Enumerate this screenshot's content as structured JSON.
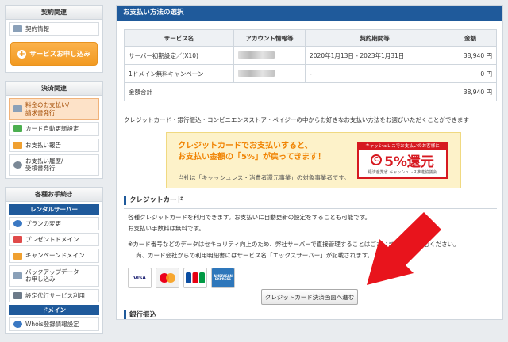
{
  "sidebar": {
    "contract": {
      "title": "契約関連",
      "items": [
        {
          "label": "契約情報",
          "icon": "document-icon"
        }
      ],
      "order_button": "サービスお申し込み"
    },
    "payment": {
      "title": "決済関連",
      "items": [
        {
          "label1": "料金のお支払い/",
          "label2": "請求書発行",
          "icon": "document-icon",
          "active": true
        },
        {
          "label1": "カード自動更新設定",
          "label2": "",
          "icon": "credit-card-icon"
        },
        {
          "label1": "お支払い報告",
          "label2": "",
          "icon": "pencil-icon"
        },
        {
          "label1": "お支払い履歴/",
          "label2": "受領書発行",
          "icon": "clock-icon"
        }
      ]
    },
    "procedures": {
      "title": "各種お手続き",
      "rental_header": "レンタルサーバー",
      "items": [
        {
          "label1": "プランの変更",
          "label2": ""
        },
        {
          "label1": "プレゼントドメイン",
          "label2": ""
        },
        {
          "label1": "キャンペーンドメイン",
          "label2": ""
        },
        {
          "label1": "バックアップデータ",
          "label2": "お申し込み"
        },
        {
          "label1": "設定代行サービス利用",
          "label2": ""
        }
      ],
      "domain_header": "ドメイン",
      "domain_item": "Whois登録情報設定"
    }
  },
  "main": {
    "title": "お支払い方法の選択",
    "table": {
      "headers": [
        "サービス名",
        "アカウント情報等",
        "契約期間等",
        "金額"
      ],
      "rows": [
        {
          "service": "サーバー初期設定／(X10)",
          "period": "2020年1月13日 - 2023年1月31日",
          "amount": "38,940 円"
        },
        {
          "service": "1ドメイン無料キャンペーン",
          "period": "-",
          "amount": "0 円"
        }
      ],
      "total_label": "金額合計",
      "total_amount": "38,940 円"
    },
    "intro": "クレジットカード・銀行振込・コンビニエンスストア・ペイジーの中からお好きなお支払い方法をお選びいただくことができます",
    "banner": {
      "line1": "クレジットカードでお支払いすると、",
      "line2": "お支払い金額の「5%」が戻ってきます！",
      "sub": "当社は「キャッシュレス・消費者還元事業」の対象事業者です。",
      "logo_top": "キャッシュレスでお支払いのお客様に",
      "logo_main": "5%還元",
      "logo_bottom": "経済産業省 キャッシュレス推進協議会"
    },
    "credit": {
      "title": "クレジットカード",
      "desc1": "各種クレジットカードを利用できます。お支払いに自動更新の設定をすることも可能です。",
      "desc2": "お支払い手数料は無料です。",
      "note1": "※カード番号などのデータはセキュリティ向上のため、弊社サーバーで直接管理することはございません。ご安心ください。",
      "note2": "尚、カード会社からの利用明細書にはサービス名「エックスサーバー」が記載されます。",
      "cards": [
        "VISA",
        "MasterCard",
        "JCB",
        "AMERICAN EXPRESS"
      ],
      "button": "クレジットカード決済画面へ進む"
    },
    "bank": {
      "title": "銀行振込"
    }
  },
  "colors": {
    "header_blue": "#1f5a9b",
    "accent_orange": "#f29a21",
    "arrow_red": "#e8141c"
  }
}
